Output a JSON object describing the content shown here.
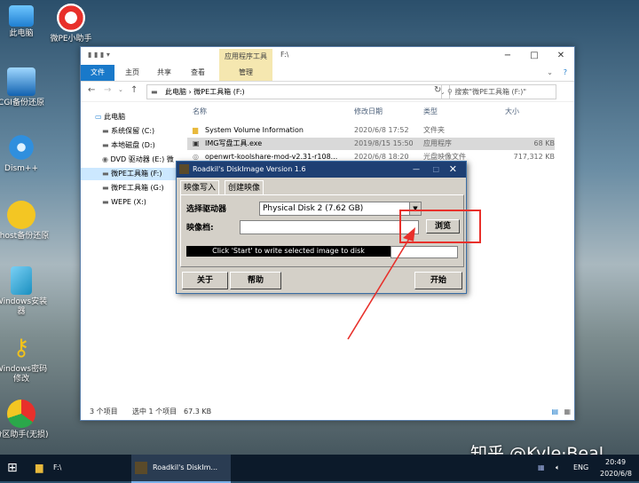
{
  "desktop": {
    "icons": [
      {
        "label": "此电脑",
        "icon": "computer-icon"
      },
      {
        "label": "微PE小助手",
        "icon": "lifebuoy-icon"
      },
      {
        "label": "CGI备份还原",
        "icon": "backup-icon"
      },
      {
        "label": "Dism++",
        "icon": "gears-icon"
      },
      {
        "label": "Ghost备份还原",
        "icon": "ghost-icon"
      },
      {
        "label": "Windows安装器",
        "icon": "windows-installer-icon"
      },
      {
        "label": "Windows密码修改",
        "icon": "key-icon"
      },
      {
        "label": "分区助手(无损)",
        "icon": "partition-icon"
      }
    ]
  },
  "explorer": {
    "title": "F:\\",
    "context_tab": "应用程序工具",
    "ribbon_tabs": [
      "文件",
      "主页",
      "共享",
      "查看",
      "管理"
    ],
    "window_controls": [
      "−",
      "□",
      "✕"
    ],
    "address_path": [
      "此电脑",
      "微PE工具箱 (F:)"
    ],
    "search_placeholder": "搜索\"微PE工具箱 (F:)\"",
    "nav": [
      "此电脑",
      "系统保留 (C:)",
      "本地磁盘 (D:)",
      "DVD 驱动器 (E:) 微",
      "微PE工具箱 (F:)",
      "微PE工具箱 (G:)",
      "WEPE (X:)"
    ],
    "columns": [
      "名称",
      "修改日期",
      "类型",
      "大小"
    ],
    "files": [
      {
        "name": "System Volume Information",
        "date": "2020/6/8 17:52",
        "type": "文件夹",
        "size": ""
      },
      {
        "name": "IMG写盘工具.exe",
        "date": "2019/8/15 15:50",
        "type": "应用程序",
        "size": "68 KB"
      },
      {
        "name": "openwrt-koolshare-mod-v2.31-r108...",
        "date": "2020/6/8 18:20",
        "type": "光盘映像文件",
        "size": "717,312 KB"
      }
    ],
    "status_count": "3 个项目",
    "status_selected": "选中 1 个项目",
    "status_size": "67.3 KB"
  },
  "dialog": {
    "title": "Roadkil's DiskImage Version 1.6",
    "tabs": [
      "映像写入",
      "创建映像"
    ],
    "drive_label": "选择驱动器",
    "drive_value": "Physical Disk 2 (7.62 GB)",
    "image_label": "映像档:",
    "browse": "浏览",
    "banner": "Click 'Start' to write selected image to disk",
    "about": "关于",
    "help": "帮助",
    "start": "开始"
  },
  "taskbar": {
    "pinned": "F:\\",
    "app": "Roadkil's DiskIm...",
    "lang": "ENG",
    "time": "20:49",
    "date": "2020/6/8"
  },
  "watermark": "知乎 @Kyle·Beal",
  "colors": {
    "highlight": "#e8302b",
    "titlebar": "#1e3f73",
    "selection": "#cce8ff"
  }
}
